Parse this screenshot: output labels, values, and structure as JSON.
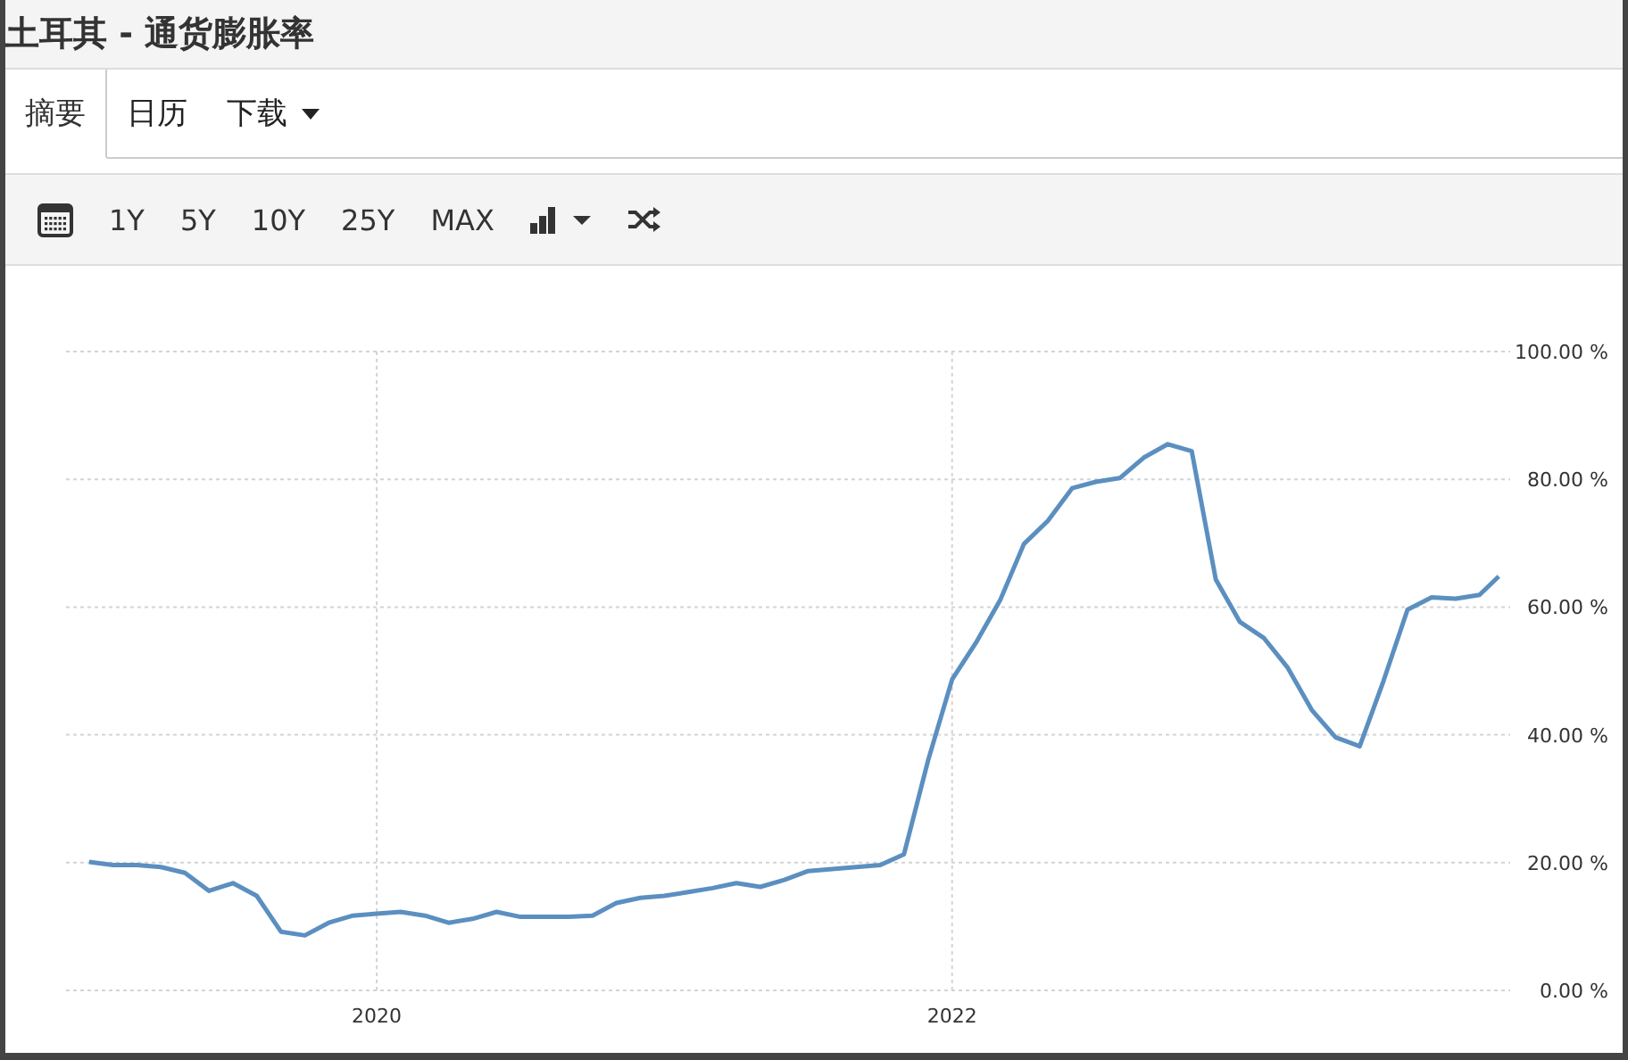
{
  "window": {
    "title": "土耳其 - 通货膨胀率"
  },
  "tabs": [
    {
      "label": "摘要",
      "selected": true,
      "dropdown": false
    },
    {
      "label": "日历",
      "selected": false,
      "dropdown": false
    },
    {
      "label": "下载",
      "selected": false,
      "dropdown": true
    }
  ],
  "toolbar": {
    "ranges": [
      "1Y",
      "5Y",
      "10Y",
      "25Y",
      "MAX"
    ]
  },
  "chart_data": {
    "type": "line",
    "xlim": [
      2018.92,
      2023.94
    ],
    "ylim": [
      0,
      100
    ],
    "xticks": [
      {
        "value": 2020,
        "label": "2020"
      },
      {
        "value": 2022,
        "label": "2022"
      }
    ],
    "yticks": [
      {
        "value": 0,
        "label": "0.00 %"
      },
      {
        "value": 20,
        "label": "20.00 %"
      },
      {
        "value": 40,
        "label": "40.00 %"
      },
      {
        "value": 60,
        "label": "60.00 %"
      },
      {
        "value": 80,
        "label": "80.00 %"
      },
      {
        "value": 100,
        "label": "100.00 %"
      }
    ],
    "x": [
      2019,
      2019.083,
      2019.167,
      2019.25,
      2019.333,
      2019.417,
      2019.5,
      2019.583,
      2019.667,
      2019.75,
      2019.833,
      2019.917,
      2020,
      2020.083,
      2020.167,
      2020.25,
      2020.333,
      2020.417,
      2020.5,
      2020.583,
      2020.667,
      2020.75,
      2020.833,
      2020.917,
      2021,
      2021.083,
      2021.167,
      2021.25,
      2021.333,
      2021.417,
      2021.5,
      2021.583,
      2021.667,
      2021.75,
      2021.833,
      2021.917,
      2022,
      2022.083,
      2022.167,
      2022.25,
      2022.333,
      2022.417,
      2022.5,
      2022.583,
      2022.667,
      2022.75,
      2022.833,
      2022.917,
      2023,
      2023.083,
      2023.167,
      2023.25,
      2023.333,
      2023.417,
      2023.5,
      2023.583,
      2023.667,
      2023.75,
      2023.833,
      2023.9
    ],
    "grid": true,
    "series": [
      {
        "color": "#5b8fc0",
        "values": [
          20.1,
          19.6,
          19.6,
          19.3,
          18.4,
          15.6,
          16.8,
          14.8,
          9.2,
          8.6,
          10.6,
          11.7,
          12.0,
          12.3,
          11.7,
          10.6,
          11.2,
          12.3,
          11.5,
          11.5,
          11.5,
          11.7,
          13.7,
          14.5,
          14.8,
          15.4,
          16.0,
          16.8,
          16.2,
          17.3,
          18.7,
          19.0,
          19.3,
          19.6,
          21.3,
          36.1,
          48.7,
          54.4,
          61.1,
          69.9,
          73.5,
          78.6,
          79.6,
          80.2,
          83.4,
          85.5,
          84.4,
          64.3,
          57.7,
          55.2,
          50.5,
          43.9,
          39.6,
          38.2,
          48.5,
          59.6,
          61.5,
          61.3,
          61.9,
          64.8
        ]
      }
    ]
  }
}
